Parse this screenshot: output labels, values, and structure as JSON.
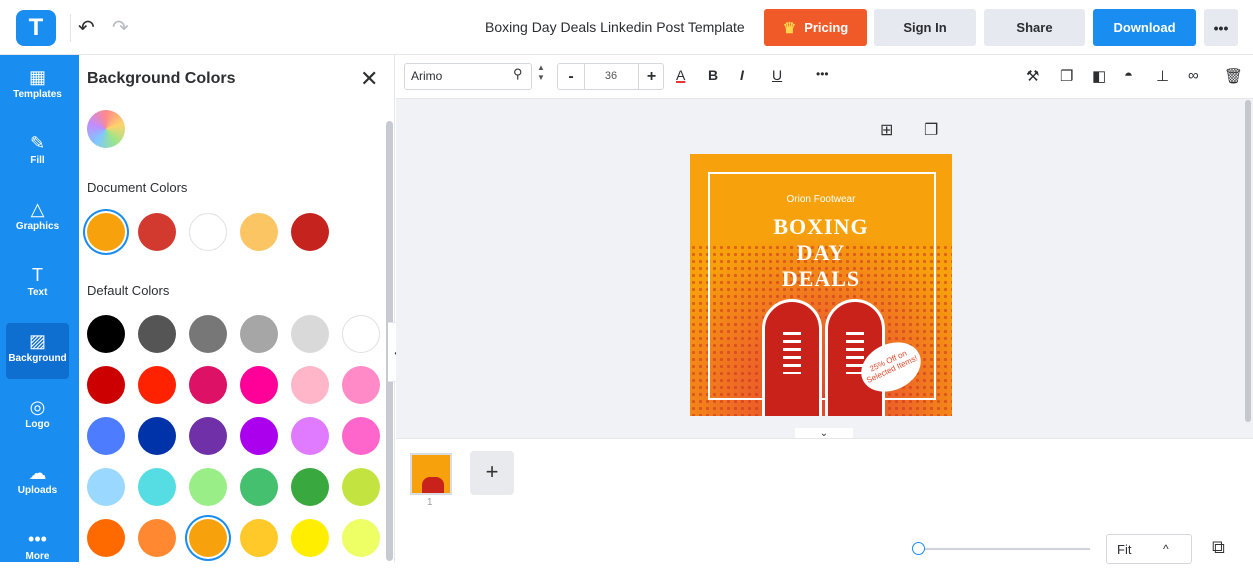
{
  "app": {
    "logo_letter": "T",
    "document_title": "Boxing Day Deals Linkedin Post Template"
  },
  "header": {
    "undo_icon": "↶",
    "redo_icon": "↷",
    "pricing_label": "Pricing",
    "crown_icon": "♛",
    "signin_label": "Sign In",
    "share_label": "Share",
    "download_label": "Download",
    "more_label": "•••"
  },
  "sidebar": {
    "items": [
      {
        "label": "Templates",
        "icon": "▦"
      },
      {
        "label": "Fill",
        "icon": "✎"
      },
      {
        "label": "Graphics",
        "icon": "△"
      },
      {
        "label": "Text",
        "icon": "T"
      },
      {
        "label": "Background",
        "icon": "▨"
      },
      {
        "label": "Logo",
        "icon": "◎"
      },
      {
        "label": "Uploads",
        "icon": "☁"
      },
      {
        "label": "More",
        "icon": "•••"
      }
    ],
    "active": "Background"
  },
  "panel": {
    "title": "Background Colors",
    "close_icon": "✕",
    "document_colors_label": "Document Colors",
    "default_colors_label": "Default Colors",
    "document_colors": [
      "#f7a20c",
      "#d33a2f",
      "#ffffff",
      "#fbc564",
      "#c4231e"
    ],
    "selected_document_color": "#f7a20c",
    "default_colors": [
      [
        "#000000",
        "#555555",
        "#777777",
        "#a6a6a6",
        "#d9d9d9",
        "#ffffff"
      ],
      [
        "#cc0000",
        "#ff2200",
        "#dd1166",
        "#ff0099",
        "#ffb6c8",
        "#ff8ac7"
      ],
      [
        "#4d7cff",
        "#0033aa",
        "#7030a8",
        "#aa00ee",
        "#e07aff",
        "#ff66cc"
      ],
      [
        "#9bd8ff",
        "#55dde3",
        "#99ee88",
        "#44c06e",
        "#38a83f",
        "#c3e440"
      ],
      [
        "#ff6a00",
        "#ff8830",
        "#f7a20c",
        "#ffc92a",
        "#ffee00",
        "#eeff66"
      ]
    ],
    "selected_default_color": "#f7a20c"
  },
  "toolbar": {
    "font_name": "Arimo",
    "font_size": "36",
    "minus": "-",
    "plus": "+",
    "text_color_icon": "A",
    "bold": "B",
    "italic": "I",
    "underline": "U",
    "more": "•••",
    "right_icons": [
      "format-painter",
      "duplicate",
      "layer",
      "opacity",
      "align",
      "link",
      "delete"
    ]
  },
  "canvas": {
    "design": {
      "brand": "Orion Footwear",
      "headline_lines": [
        "BOXING",
        "DAY",
        "DEALS"
      ],
      "badge_text": "25% Off on Selected Items!"
    }
  },
  "pages": {
    "thumb_number": "1",
    "add_icon": "+"
  },
  "zoom": {
    "fit_label": "Fit",
    "caret": "^"
  },
  "colors": {
    "brand_blue": "#1a8df0",
    "pricing_orange": "#f05a28"
  }
}
